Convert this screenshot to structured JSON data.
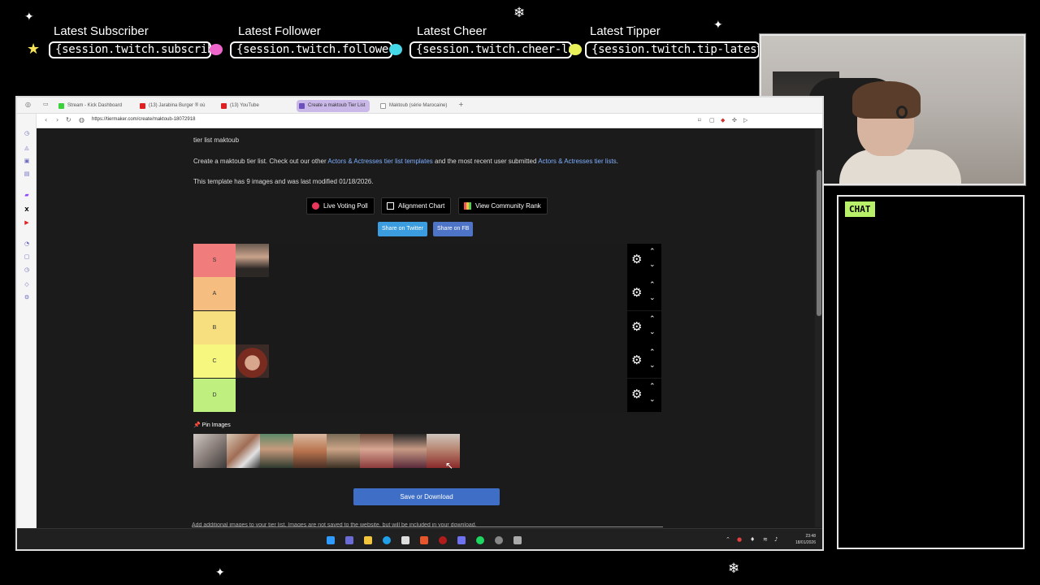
{
  "overlay": {
    "alerts": [
      {
        "label": "Latest Subscriber",
        "value": "{session.twitch.subscriber-latest.name}",
        "gem_color": "#ee66cc"
      },
      {
        "label": "Latest Follower",
        "value": "{session.twitch.follower-latest.name}",
        "gem_color": "#44d8e8"
      },
      {
        "label": "Latest Cheer",
        "value": "{session.twitch.cheer-latest.name}",
        "gem_color": "#e8f05a"
      },
      {
        "label": "Latest Tipper",
        "value": "{session.twitch.tip-latest.name}",
        "gem_color": "#e8f05a"
      }
    ],
    "chat_title": "CHAT"
  },
  "browser": {
    "tabs": [
      {
        "label": "Stream - Kick Dashboard",
        "color": "#3ad13a"
      },
      {
        "label": "(13) Jarabina Burger ® où",
        "color": "#e02020"
      },
      {
        "label": "(13) YouTube",
        "color": "#e02020"
      },
      {
        "label": "Create a maktoub Tier List",
        "color": "#6b4fbb"
      },
      {
        "label": "Maktoub (série Marocaine)",
        "color": "#555555"
      }
    ],
    "new_tab": "+",
    "url": "https://tiermaker.com/create/maktoub-18072918"
  },
  "page": {
    "crumb": "tier list maktoub",
    "desc_pre": "Create a maktoub tier list. Check out our other ",
    "desc_link1": "Actors & Actresses tier list templates",
    "desc_mid": " and the most recent user submitted ",
    "desc_link2": "Actors & Actresses tier lists",
    "desc_post": ".",
    "info": "This template has 9 images and was last modified 01/18/2026.",
    "btn_live": "Live Voting Poll",
    "btn_alignment": "Alignment Chart",
    "btn_rank": "View Community Rank",
    "btn_twitter": "Share on Twitter",
    "btn_fb": "Share on FB",
    "tiers": [
      {
        "label": "S",
        "color": "#f07c7c"
      },
      {
        "label": "A",
        "color": "#f5bd7f"
      },
      {
        "label": "B",
        "color": "#f7df80"
      },
      {
        "label": "C",
        "color": "#f6f77e"
      },
      {
        "label": "D",
        "color": "#bff07f"
      }
    ],
    "pin_label": "Pin Images",
    "save_btn": "Save or Download",
    "bottom_note": "Add additional images to your tier list. Images are not saved to the website, but will be included in your download."
  },
  "taskbar": {
    "time": "23:48",
    "date": "18/01/2026"
  }
}
